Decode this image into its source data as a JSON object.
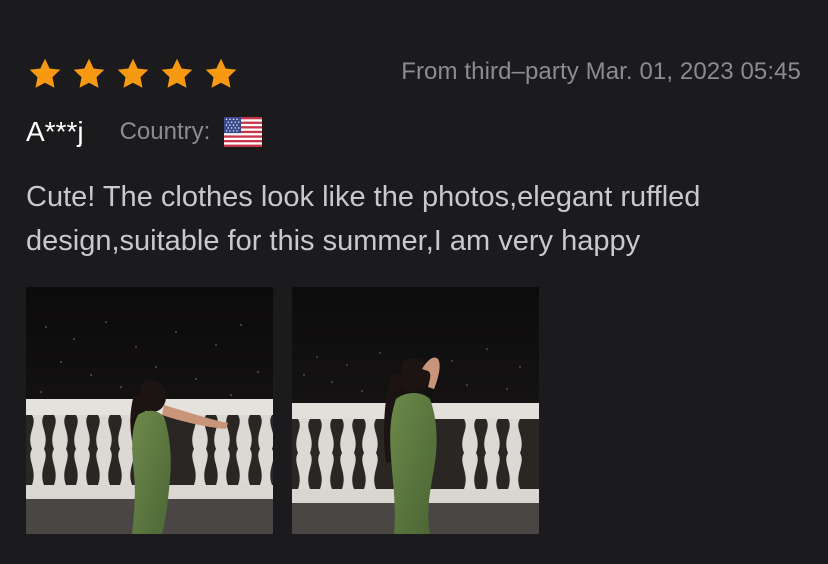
{
  "review": {
    "rating": 5,
    "rating_max": 5,
    "star_color": "#f79a12",
    "source_date": "From third–party Mar. 01, 2023 05:45",
    "author": "A***j",
    "country_label": "Country:",
    "country_flag_icon": "us-flag-icon",
    "text": "Cute! The clothes look like the photos,elegant ruffled design,suitable for this summer,I am very happy",
    "photos": [
      {
        "name": "review-photo-1"
      },
      {
        "name": "review-photo-2"
      }
    ]
  }
}
